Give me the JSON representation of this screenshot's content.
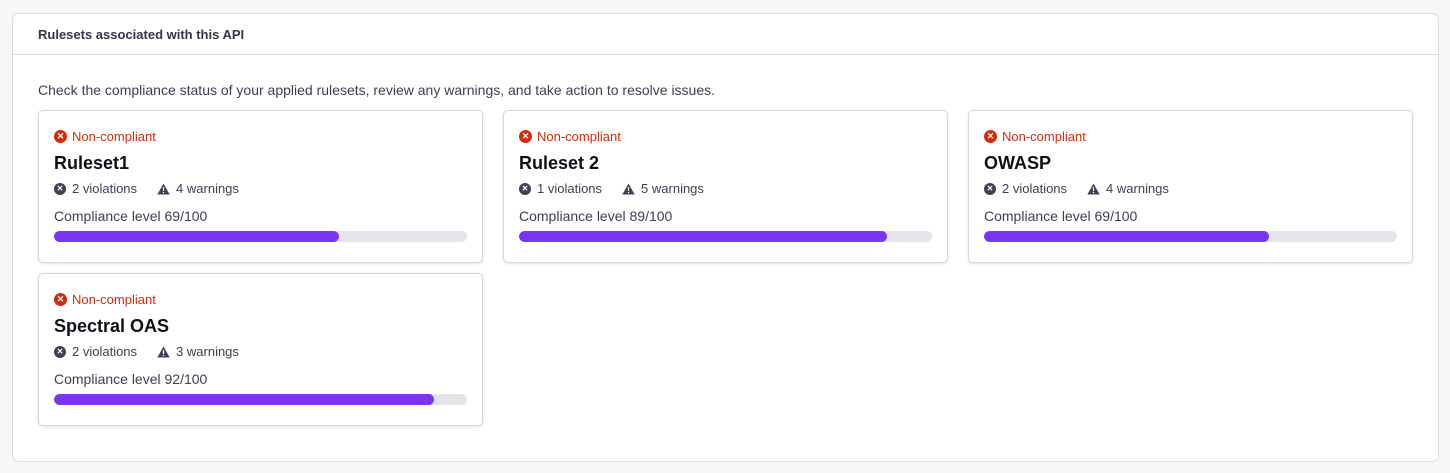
{
  "panel": {
    "title": "Rulesets associated with this API",
    "description": "Check the compliance status of your applied rulesets, review any warnings, and take action to resolve issues."
  },
  "colors": {
    "non_compliant": "#d42a0c",
    "progress": "#7a35f2",
    "track": "#e4e4ea"
  },
  "icons": {
    "status": "x-circle-icon",
    "violations": "x-circle-icon",
    "warnings": "warning-triangle-icon"
  },
  "rulesets": [
    {
      "status": "Non-compliant",
      "name": "Ruleset1",
      "violations": "2 violations",
      "warnings": "4 warnings",
      "compliance_label": "Compliance level 69/100",
      "compliance_fraction": 0.69
    },
    {
      "status": "Non-compliant",
      "name": "Ruleset 2",
      "violations": "1 violations",
      "warnings": "5 warnings",
      "compliance_label": "Compliance level 89/100",
      "compliance_fraction": 0.89
    },
    {
      "status": "Non-compliant",
      "name": "OWASP",
      "violations": "2 violations",
      "warnings": "4 warnings",
      "compliance_label": "Compliance level 69/100",
      "compliance_fraction": 0.69
    },
    {
      "status": "Non-compliant",
      "name": "Spectral OAS",
      "violations": "2 violations",
      "warnings": "3 warnings",
      "compliance_label": "Compliance level 92/100",
      "compliance_fraction": 0.92
    }
  ]
}
